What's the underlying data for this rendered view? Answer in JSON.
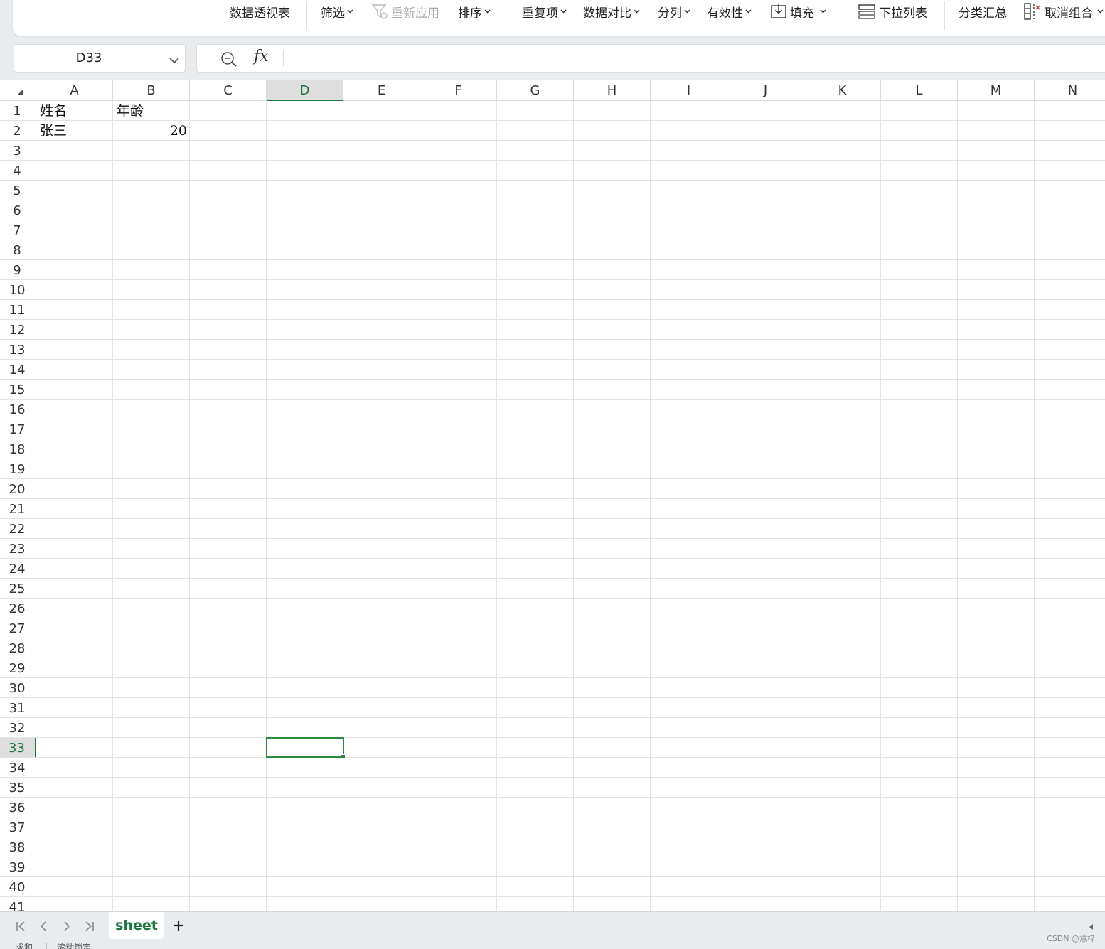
{
  "ribbon": {
    "pivot_table": "数据透视表",
    "filter": "筛选",
    "reapply": "重新应用",
    "sort": "排序",
    "duplicates": "重复项",
    "data_compare": "数据对比",
    "split_columns": "分列",
    "validation": "有效性",
    "fill": "填充",
    "dropdown_list": "下拉列表",
    "subtotal": "分类汇总",
    "ungroup": "取消组合"
  },
  "name_box": {
    "value": "D33"
  },
  "formula_bar": {
    "fx_label": "fx",
    "value": ""
  },
  "columns": [
    "A",
    "B",
    "C",
    "D",
    "E",
    "F",
    "G",
    "H",
    "I",
    "J",
    "K",
    "L",
    "M",
    "N"
  ],
  "active_column": "D",
  "rows": [
    "1",
    "2",
    "3",
    "4",
    "5",
    "6",
    "7",
    "8",
    "9",
    "10",
    "11",
    "12",
    "13",
    "14",
    "15",
    "16",
    "17",
    "18",
    "19",
    "20",
    "21",
    "22",
    "23",
    "24",
    "25",
    "26",
    "27",
    "28",
    "29",
    "30",
    "31",
    "32",
    "33",
    "34",
    "35",
    "36",
    "37",
    "38",
    "39",
    "40",
    "41"
  ],
  "active_row": "33",
  "cells": {
    "A1": "姓名",
    "B1": "年龄",
    "A2": "张三",
    "B2": "20"
  },
  "sheet_tabs": {
    "active": "sheet"
  },
  "status_bar": {
    "left": "求和",
    "mode": "滚动锁定"
  },
  "watermark": "CSDN @意梓",
  "colors": {
    "accent": "#1a7a3e",
    "selection": "#2e8a3c"
  }
}
